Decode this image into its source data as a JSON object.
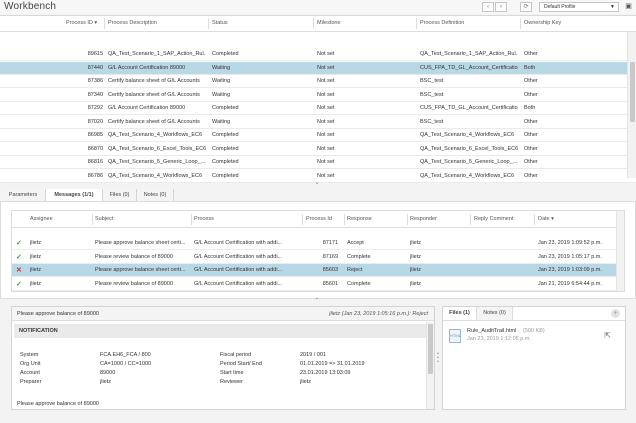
{
  "app": {
    "title": "Workbench",
    "profile": "Default Profile",
    "nav": {
      "prev": "‹",
      "next": "›",
      "refresh": "⟳"
    }
  },
  "process_grid": {
    "columns": [
      "Process ID ▾",
      "Process Description",
      "Status",
      "Milestone",
      "Process Definition",
      "Ownership Key"
    ],
    "rows": [
      [
        "89615",
        "QA_Test_Scenario_1_SAP_Action_Rul...",
        "Completed",
        "Not set",
        "QA_Test_Scenario_1_SAP_Action_Rul...",
        "Other"
      ],
      [
        "87440",
        "G/L Account Certification 89000",
        "Waiting",
        "Not set",
        "CUS_FPA_TD_GL_Account_Certification...",
        "Both"
      ],
      [
        "87386",
        "Certify balance sheet of G/L Accounts",
        "Waiting",
        "Not set",
        "BSC_test",
        "Other"
      ],
      [
        "87340",
        "Certify balance sheet of G/L Accounts",
        "Waiting",
        "Not set",
        "BSC_test",
        "Other"
      ],
      [
        "87292",
        "G/L Account Certification 89000",
        "Completed",
        "Not set",
        "CUS_FPA_TD_GL_Account_Certification...",
        "Both"
      ],
      [
        "87020",
        "Certify balance sheet of G/L Accounts",
        "Waiting",
        "Not set",
        "BSC_test",
        "Other"
      ],
      [
        "86985",
        "QA_Test_Scenario_4_Workflows_EC6",
        "Completed",
        "Not set",
        "QA_Test_Scenario_4_Workflows_EC6",
        "Other"
      ],
      [
        "86870",
        "QA_Test_Scenario_6_Excel_Tools_EC6",
        "Completed",
        "Not set",
        "QA_Test_Scenario_6_Excel_Tools_EC6",
        "Other"
      ],
      [
        "86816",
        "QA_Test_Scenario_5_Generic_Loop_...",
        "Completed",
        "Not set",
        "QA_Test_Scenario_5_Generic_Loop_...",
        "Other"
      ],
      [
        "86786",
        "QA_Test_Scenario_4_Workflows_EC6",
        "Completed",
        "Not set",
        "QA_Test_Scenario_4_Workflows_EC6",
        "Other"
      ]
    ]
  },
  "tabs": [
    "Parameters",
    "Messages (1/1)",
    "Files (0)",
    "Notes (0)"
  ],
  "messages_grid": {
    "columns": [
      "Assignee",
      "Subject",
      "Process",
      "Process Id",
      "Response",
      "Responder",
      "Reply Comment",
      "Date ▾"
    ],
    "rows": [
      {
        "icon": "check",
        "cells": [
          "jlietz",
          "Please approve balance sheet certi...",
          "G/L Account Certification with addi...",
          "87171",
          "Accept",
          "jlietz",
          "",
          "Jan 23, 2019 1:09:52 p.m."
        ]
      },
      {
        "icon": "check",
        "cells": [
          "jlietz",
          "Please review balance of 89000",
          "G/L Account Certification with addi...",
          "87169",
          "Complete",
          "jlietz",
          "",
          "Jan 23, 2019 1:05:17 p.m."
        ]
      },
      {
        "icon": "cross",
        "cells": [
          "jlietz",
          "Please approve balance sheet certi...",
          "G/L Account Certification with addi...",
          "85603",
          "Reject",
          "jlietz",
          "",
          "Jan 23, 2019 1:03:09 p.m."
        ]
      },
      {
        "icon": "check",
        "cells": [
          "jlietz",
          "Please review balance of 89000",
          "G/L Account Certification with addi...",
          "85601",
          "Complete",
          "jlietz",
          "",
          "Jan 21, 2019 6:54:44 p.m."
        ]
      }
    ]
  },
  "detail": {
    "subject": "Please approve balance of 89000",
    "meta": "jlietz (Jan 23, 2019 1:05:16 p.m.): Reject",
    "notification": "NOTIFICATION",
    "left": [
      [
        "System",
        "FCA.EH6_FCA / 800"
      ],
      [
        "Org Unit",
        "CA=1000 / CC=1000"
      ],
      [
        "Account",
        "89000"
      ],
      [
        "Preparer",
        "jlietz"
      ]
    ],
    "right": [
      [
        "Fiscal period",
        "2019 / 001"
      ],
      [
        "Period Start/ End",
        "01.01.2019 => 31.01.2019"
      ],
      [
        "Start time",
        "23.01.2019 13:03:09"
      ],
      [
        "Reviewer",
        "jlietz"
      ]
    ],
    "body": "Please approve balance of 89000"
  },
  "files_panel": {
    "tabs": [
      "Files (1)",
      "Notes (0)"
    ],
    "file": {
      "name": "Rule_AuditTrail.html",
      "size": "(500 KB)",
      "date": "Jan 23, 2019 1:12:05 p.m."
    }
  }
}
